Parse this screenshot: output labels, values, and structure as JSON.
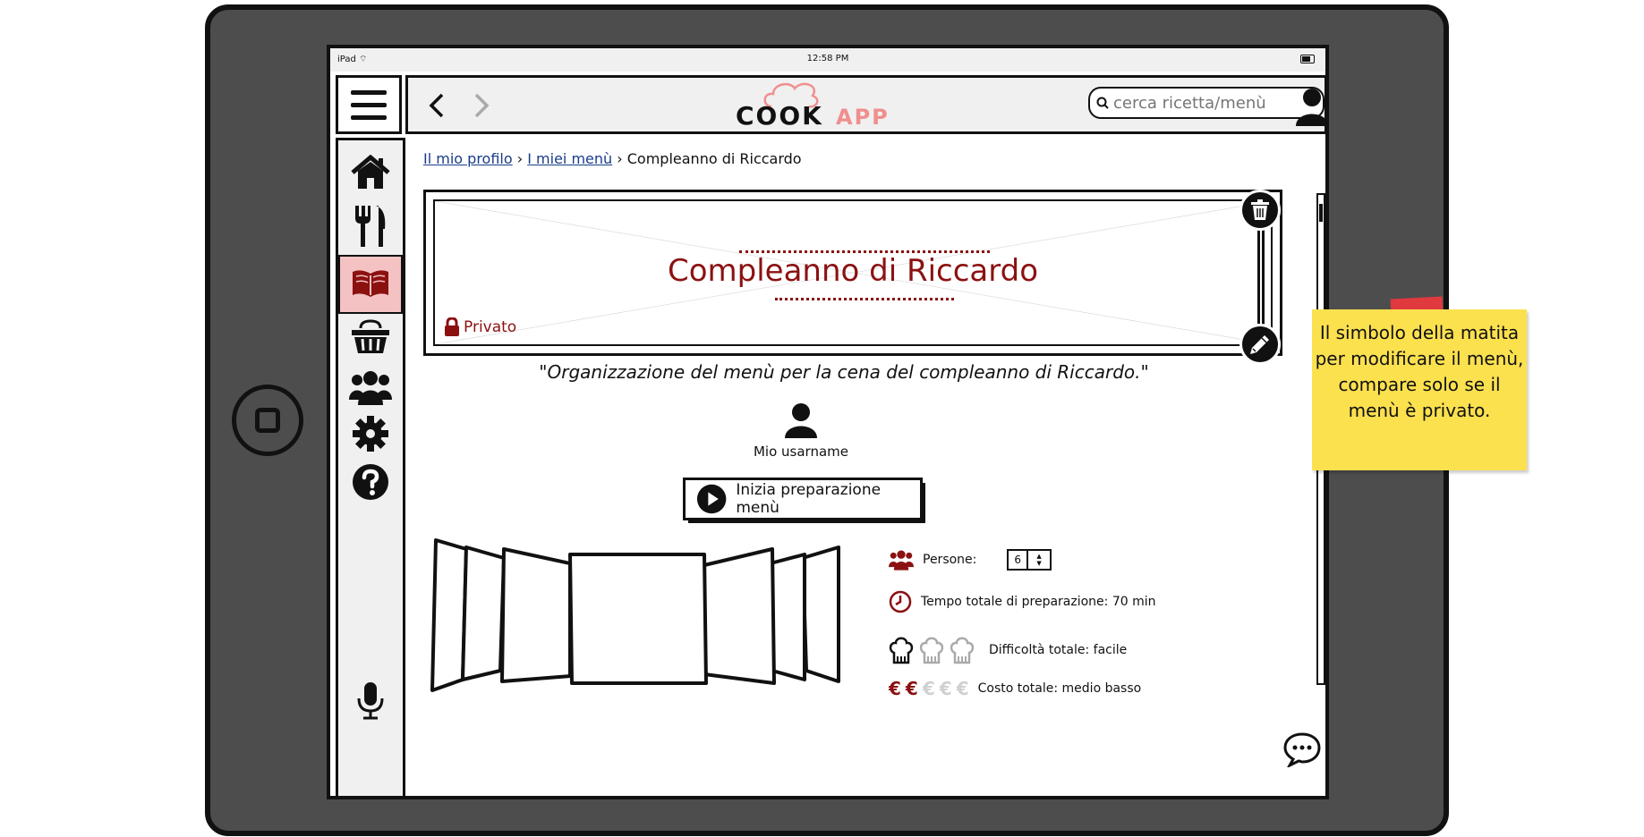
{
  "status_bar": {
    "device": "iPad",
    "time": "12:58 PM"
  },
  "header": {
    "logo_main": "COOK",
    "logo_accent": "APP",
    "search_placeholder": "cerca ricetta/menù"
  },
  "breadcrumb": [
    {
      "label": "Il mio profilo",
      "link": true
    },
    {
      "label": "I miei menù",
      "link": true
    },
    {
      "label": "Compleanno di Riccardo",
      "link": false
    }
  ],
  "menu": {
    "title": "Compleanno di Riccardo",
    "visibility": "Privato",
    "description": "\"Organizzazione del menù per la cena del compleanno di Riccardo.\"",
    "author": "Mio usarname",
    "start_button": "Inizia preparazione menù"
  },
  "details": {
    "persons_label": "Persone:",
    "persons_value": "6",
    "time_label": "Tempo totale di preparazione: 70 min",
    "difficulty_label": "Difficoltà totale: facile",
    "difficulty_level": 1,
    "difficulty_max": 3,
    "cost_label": "Costo totale: medio basso",
    "cost_level": 2,
    "cost_max": 5,
    "cost_symbol": "€"
  },
  "sticky_note": {
    "text": "Il simbolo della matita per modificare il menù, compare solo se il menù è privato."
  },
  "colors": {
    "accent": "#8b1111",
    "active_nav": "#f4c2c2",
    "sticky": "#fce14f",
    "tape": "#e0393e",
    "logo_accent": "#f08f8f"
  }
}
